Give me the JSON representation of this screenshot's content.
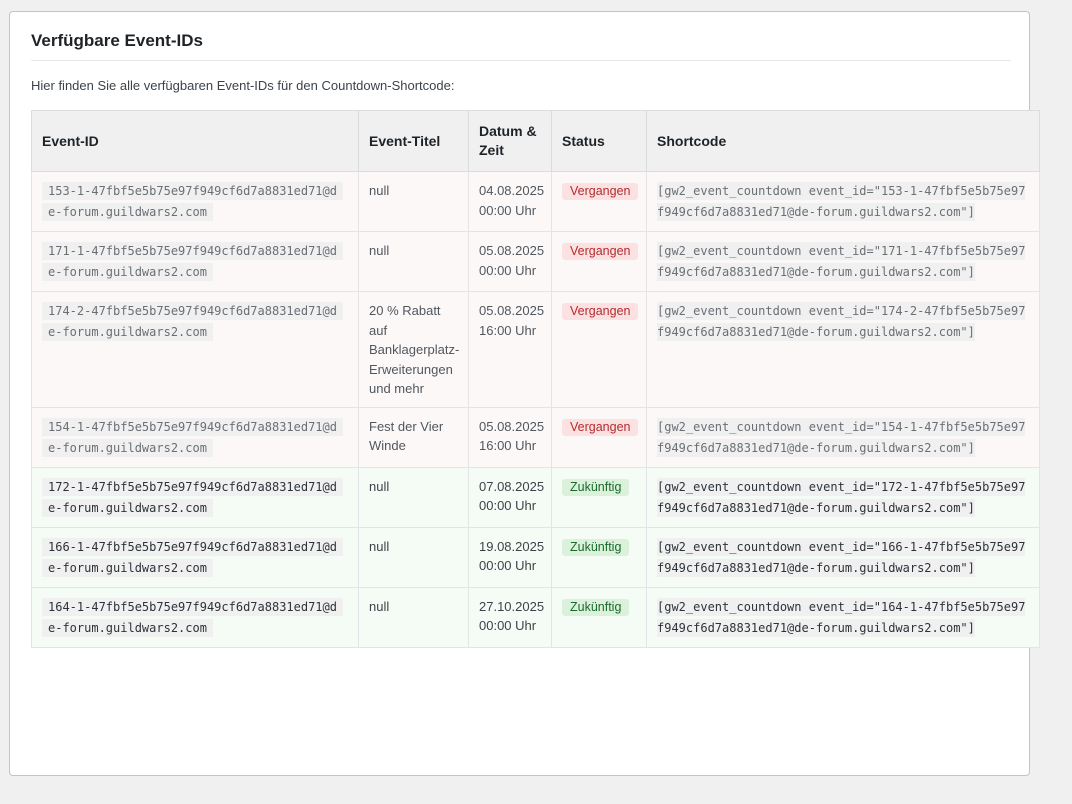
{
  "panel": {
    "title": "Verfügbare Event-IDs",
    "intro": "Hier finden Sie alle verfügbaren Event-IDs für den Countdown-Shortcode:"
  },
  "table": {
    "headers": {
      "id": "Event-ID",
      "title": "Event-Titel",
      "date": "Datum & Zeit",
      "status": "Status",
      "shortcode": "Shortcode"
    },
    "rows": [
      {
        "id": "153-1-47fbf5e5b75e97f949cf6d7a8831ed71@de-forum.guildwars2.com",
        "title": "null",
        "date": "04.08.2025 00:00 Uhr",
        "status": "Vergangen",
        "status_type": "past",
        "shortcode": "[gw2_event_countdown event_id=\"153-1-47fbf5e5b75e97f949cf6d7a8831ed71@de-forum.guildwars2.com\"]"
      },
      {
        "id": "171-1-47fbf5e5b75e97f949cf6d7a8831ed71@de-forum.guildwars2.com",
        "title": "null",
        "date": "05.08.2025 00:00 Uhr",
        "status": "Vergangen",
        "status_type": "past",
        "shortcode": "[gw2_event_countdown event_id=\"171-1-47fbf5e5b75e97f949cf6d7a8831ed71@de-forum.guildwars2.com\"]"
      },
      {
        "id": "174-2-47fbf5e5b75e97f949cf6d7a8831ed71@de-forum.guildwars2.com",
        "title": "20 % Rabatt auf Banklagerplatz-Erweiterungen und mehr",
        "date": "05.08.2025 16:00 Uhr",
        "status": "Vergangen",
        "status_type": "past",
        "shortcode": "[gw2_event_countdown event_id=\"174-2-47fbf5e5b75e97f949cf6d7a8831ed71@de-forum.guildwars2.com\"]"
      },
      {
        "id": "154-1-47fbf5e5b75e97f949cf6d7a8831ed71@de-forum.guildwars2.com",
        "title": "Fest der Vier Winde",
        "date": "05.08.2025 16:00 Uhr",
        "status": "Vergangen",
        "status_type": "past",
        "shortcode": "[gw2_event_countdown event_id=\"154-1-47fbf5e5b75e97f949cf6d7a8831ed71@de-forum.guildwars2.com\"]"
      },
      {
        "id": "172-1-47fbf5e5b75e97f949cf6d7a8831ed71@de-forum.guildwars2.com",
        "title": "null",
        "date": "07.08.2025 00:00 Uhr",
        "status": "Zukünftig",
        "status_type": "future",
        "shortcode": "[gw2_event_countdown event_id=\"172-1-47fbf5e5b75e97f949cf6d7a8831ed71@de-forum.guildwars2.com\"]"
      },
      {
        "id": "166-1-47fbf5e5b75e97f949cf6d7a8831ed71@de-forum.guildwars2.com",
        "title": "null",
        "date": "19.08.2025 00:00 Uhr",
        "status": "Zukünftig",
        "status_type": "future",
        "shortcode": "[gw2_event_countdown event_id=\"166-1-47fbf5e5b75e97f949cf6d7a8831ed71@de-forum.guildwars2.com\"]"
      },
      {
        "id": "164-1-47fbf5e5b75e97f949cf6d7a8831ed71@de-forum.guildwars2.com",
        "title": "null",
        "date": "27.10.2025 00:00 Uhr",
        "status": "Zukünftig",
        "status_type": "future",
        "shortcode": "[gw2_event_countdown event_id=\"164-1-47fbf5e5b75e97f949cf6d7a8831ed71@de-forum.guildwars2.com\"]"
      }
    ]
  },
  "colors": {
    "past_badge_bg": "#fce1e3",
    "past_badge_text": "#b32d2e",
    "future_badge_bg": "#dcf1dc",
    "future_badge_text": "#1a6b2a"
  }
}
